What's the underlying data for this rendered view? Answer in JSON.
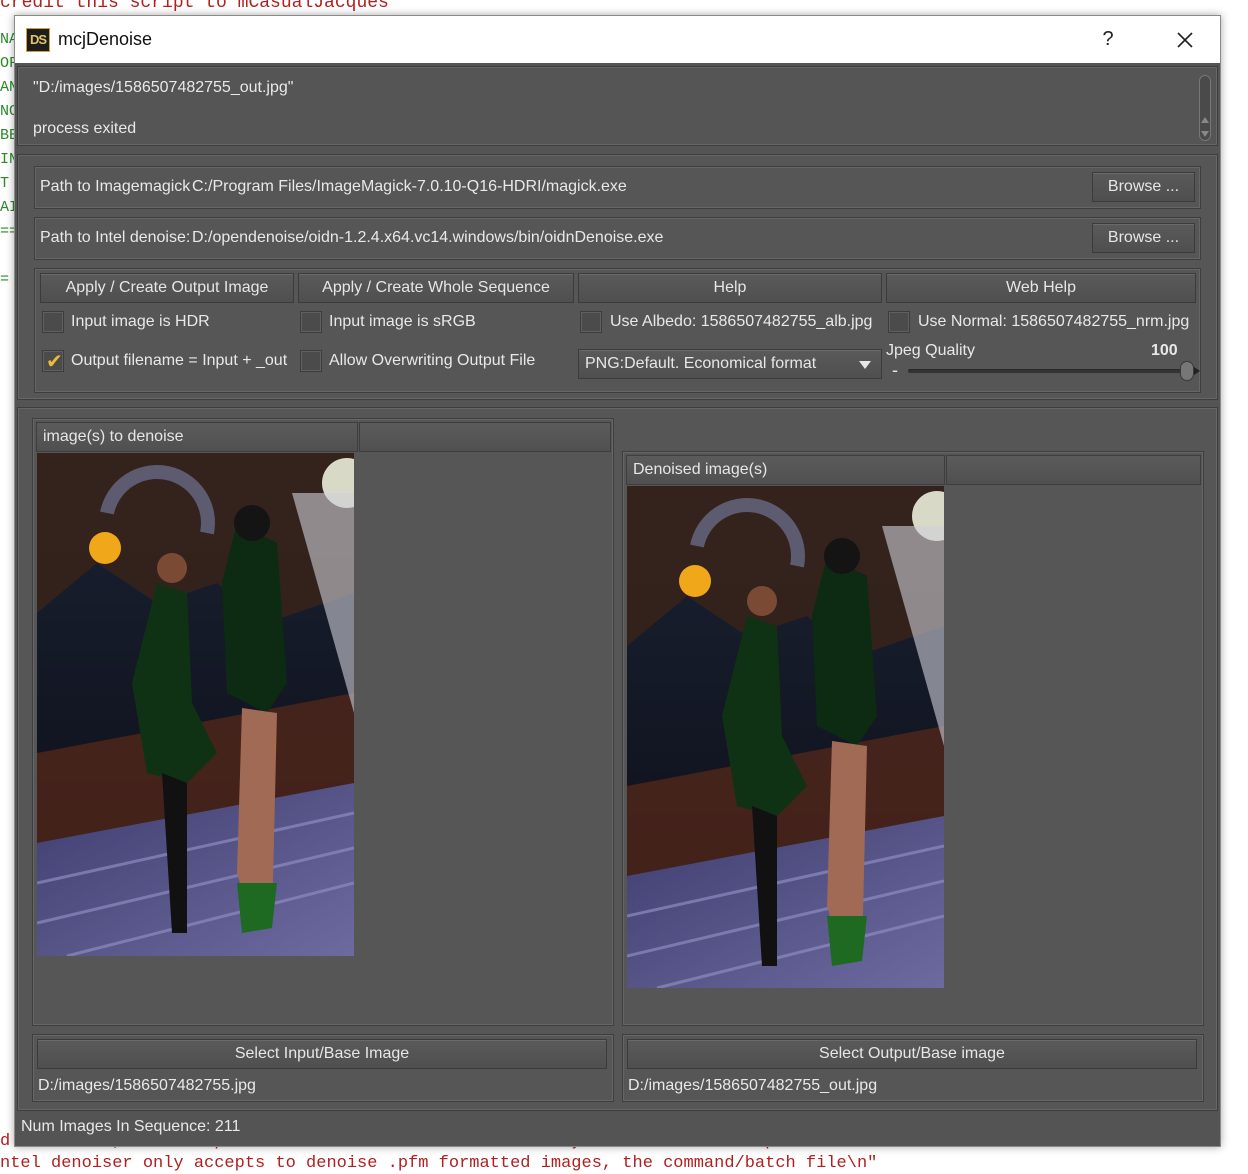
{
  "background_editor": {
    "top_line": "credit this script to mCasualJacques",
    "bottom_lines": [
      "d the scene, the script creates a command/batch file in your DAZ Studio temp folder\\n",
      "ntel denoiser only accepts to denoise .pfm formatted images, the command/batch file\\n\""
    ]
  },
  "window": {
    "app_icon_text": "DS",
    "title": "mcjDenoise",
    "help_symbol": "?",
    "close_icon": "close-x-icon"
  },
  "log": {
    "line1": "\"D:/images/1586507482755_out.jpg\"",
    "line2": "process exited"
  },
  "paths": {
    "imagemagick_label": "Path to Imagemagick",
    "imagemagick_value": "C:/Program Files/ImageMagick-7.0.10-Q16-HDRI/magick.exe",
    "imagemagick_browse": "Browse ...",
    "intel_label": "Path to Intel denoise:",
    "intel_value": "D:/opendenoise/oidn-1.2.4.x64.vc14.windows/bin/oidnDenoise.exe",
    "intel_browse": "Browse ..."
  },
  "actions": {
    "apply_output": "Apply / Create Output Image",
    "apply_sequence": "Apply / Create Whole Sequence",
    "help": "Help",
    "web_help": "Web Help"
  },
  "options": {
    "input_hdr": {
      "label": "Input image is HDR",
      "checked": false
    },
    "input_srgb": {
      "label": "Input image is sRGB",
      "checked": false
    },
    "use_albedo": {
      "label": "Use Albedo: 1586507482755_alb.jpg",
      "checked": false
    },
    "use_normal": {
      "label": "Use Normal: 1586507482755_nrm.jpg",
      "checked": false
    },
    "output_filename": {
      "label": "Output filename = Input + _out",
      "checked": true
    },
    "allow_overwrite": {
      "label": "Allow Overwriting Output File",
      "checked": false
    },
    "format_select": "PNG:Default. Economical format",
    "jpeg_quality_label": "Jpeg Quality",
    "jpeg_quality_value": "100",
    "jpeg_quality_min_symbol": "-",
    "jpeg_quality": 100
  },
  "input_panel": {
    "header": "image(s) to denoise",
    "select_button": "Select Input/Base Image",
    "path": "D:/images/1586507482755.jpg"
  },
  "output_panel": {
    "header": "Denoised image(s)",
    "select_button": "Select Output/Base image",
    "path": "D:/images/1586507482755_out.jpg"
  },
  "status": {
    "num_images": "Num Images In Sequence: 211"
  },
  "colors": {
    "window_bg": "#545454",
    "accent_check": "#f0b93a",
    "text": "#e8e8e8"
  }
}
